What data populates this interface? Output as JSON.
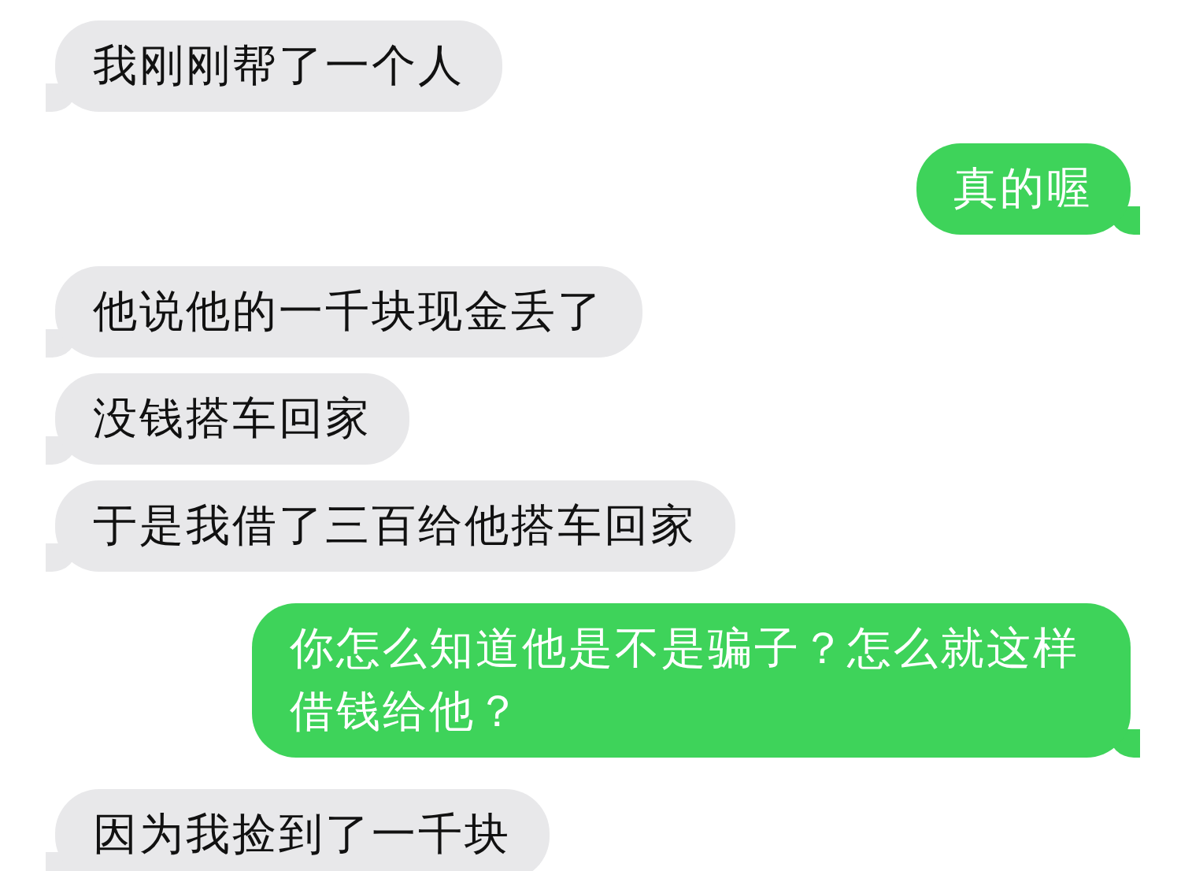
{
  "messages": [
    {
      "kind": "received",
      "text": "我刚刚帮了一个人"
    },
    {
      "kind": "sent",
      "text": "真的喔"
    },
    {
      "kind": "received",
      "text": "他说他的一千块现金丢了"
    },
    {
      "kind": "received",
      "text": "没钱搭车回家"
    },
    {
      "kind": "received",
      "text": "于是我借了三百给他搭车回家"
    },
    {
      "kind": "sent",
      "text": "你怎么知道他是不是骗子？怎么就这样借钱给他？"
    },
    {
      "kind": "received",
      "text": "因为我捡到了一千块"
    }
  ]
}
